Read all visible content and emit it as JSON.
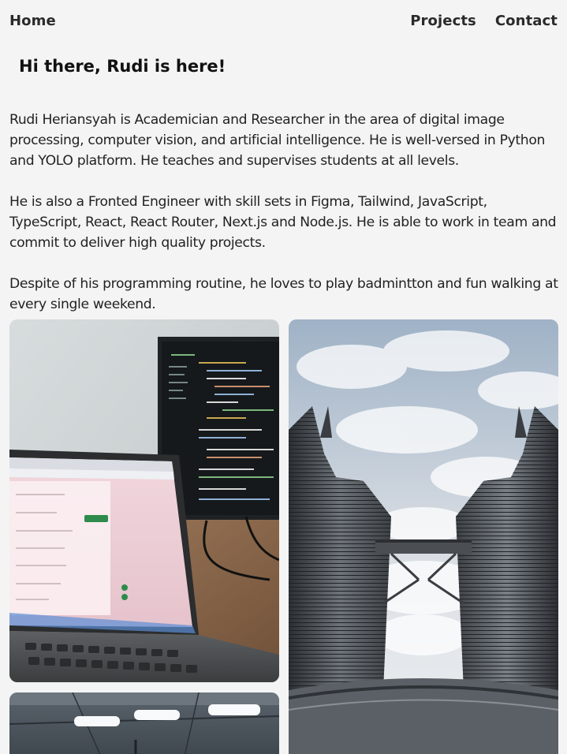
{
  "nav": {
    "home_label": "Home",
    "projects_label": "Projects",
    "contact_label": "Contact"
  },
  "hero": {
    "title": "Hi there, Rudi is here!"
  },
  "bio": {
    "paragraph_1": "Rudi Heriansyah is Academician and Researcher in the area of digital image processing, computer vision, and artificial intelligence. He is well-versed in Python and YOLO platform. He teaches and supervises students at all levels.",
    "paragraph_2": "He is also a Fronted Engineer with skill sets in Figma, Tailwind, JavaScript, TypeScript, React, React Router, Next.js and Node.js. He is able to work in team and commit to deliver high quality projects.",
    "paragraph_3": "Despite of his programming routine, he loves to play badmintton and fun walking at every single weekend."
  },
  "gallery": {
    "photos": [
      {
        "name": "laptop-workspace-photo"
      },
      {
        "name": "twin-towers-photo"
      },
      {
        "name": "badminton-hall-photo"
      }
    ]
  },
  "colors": {
    "background": "#f4f4f4",
    "text": "#222222",
    "nav_text": "#2a2a2a"
  }
}
